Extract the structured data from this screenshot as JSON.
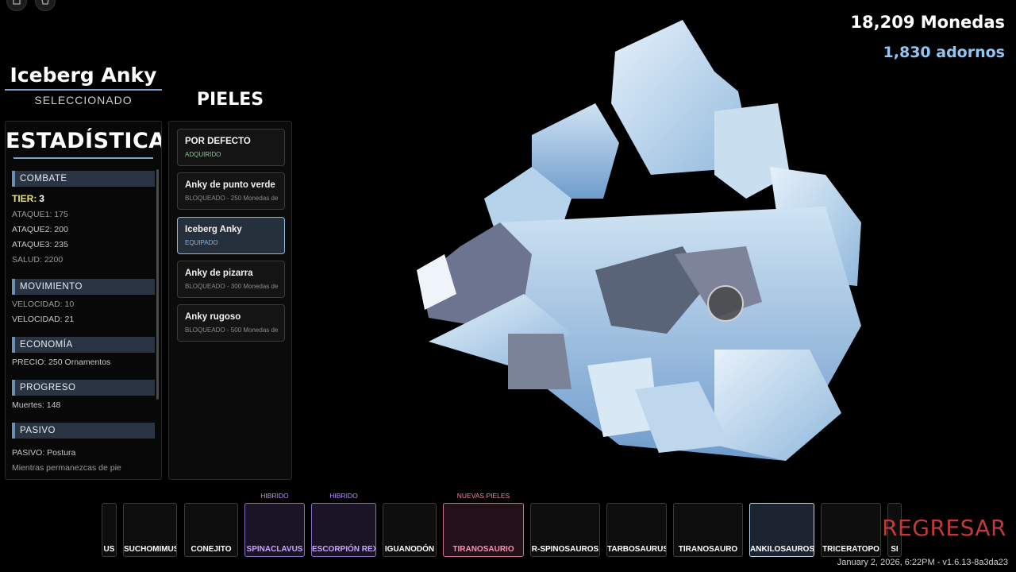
{
  "currency": {
    "coins": "18,209 Monedas",
    "ornaments": "1,830 adornos"
  },
  "selected": {
    "name": "Iceberg Anky",
    "status": "SELECCIONADO"
  },
  "stats": {
    "heading": "ESTADÍSTICAS",
    "combat": {
      "header": "COMBATE",
      "tier_label": "TIER:",
      "tier_value": "3",
      "lines": [
        "ATAQUE1: 175",
        "ATAQUE2: 200",
        "ATAQUE3: 235",
        "SALUD: 2200"
      ]
    },
    "movement": {
      "header": "MOVIMIENTO",
      "lines": [
        "VELOCIDAD: 10",
        "VELOCIDAD: 21"
      ]
    },
    "economy": {
      "header": "ECONOMÍA",
      "lines": [
        "PRECIO: 250 Ornamentos"
      ]
    },
    "progress": {
      "header": "PROGRESO",
      "lines": [
        "Muertes: 148"
      ]
    },
    "passive": {
      "header": "PASIVO",
      "lines": [
        "PASIVO: Postura",
        "Mientras permanezcas de pie"
      ]
    }
  },
  "skins": {
    "title": "PIELES",
    "items": [
      {
        "name": "POR DEFECTO",
        "status": "ADQUIRIDO"
      },
      {
        "name": "Anky de punto verde",
        "status": "BLOQUEADO - 250 Monedas de"
      },
      {
        "name": "Iceberg Anky",
        "status": "EQUIPADO"
      },
      {
        "name": "Anky de pizarra",
        "status": "BLOQUEADO - 300 Monedas de"
      },
      {
        "name": "Anky rugoso",
        "status": "BLOQUEADO - 500 Monedas de"
      }
    ]
  },
  "roster": {
    "items": [
      {
        "label": "US",
        "tag": ""
      },
      {
        "label": "SUCHOMIMUS",
        "tag": ""
      },
      {
        "label": "CONEJITO",
        "tag": ""
      },
      {
        "label": "SPINACLAVUS",
        "tag": "HIBRIDO"
      },
      {
        "label": "ESCORPIÓN REX",
        "tag": "HIBRIDO"
      },
      {
        "label": "IGUANODÓN",
        "tag": ""
      },
      {
        "label": "TIRANOSAURIO",
        "tag": "NUEVAS PIELES"
      },
      {
        "label": "R-SPINOSAUROS",
        "tag": ""
      },
      {
        "label": "TARBOSAURUS",
        "tag": ""
      },
      {
        "label": "TIRANOSAURO",
        "tag": ""
      },
      {
        "label": "ANKILOSAUROS",
        "tag": ""
      },
      {
        "label": "TRICERATOPO",
        "tag": ""
      },
      {
        "label": "SI",
        "tag": ""
      }
    ]
  },
  "back_label": "REGRESAR",
  "version": "January 2, 2026, 6:22PM - v1.6.13-8a3da23",
  "colors": {
    "accent": "#7fa3c8",
    "back": "#c13a3a",
    "ornaments": "#8ec6f5",
    "hybrid": "#b993ff",
    "new_skins": "#ff7fae"
  }
}
